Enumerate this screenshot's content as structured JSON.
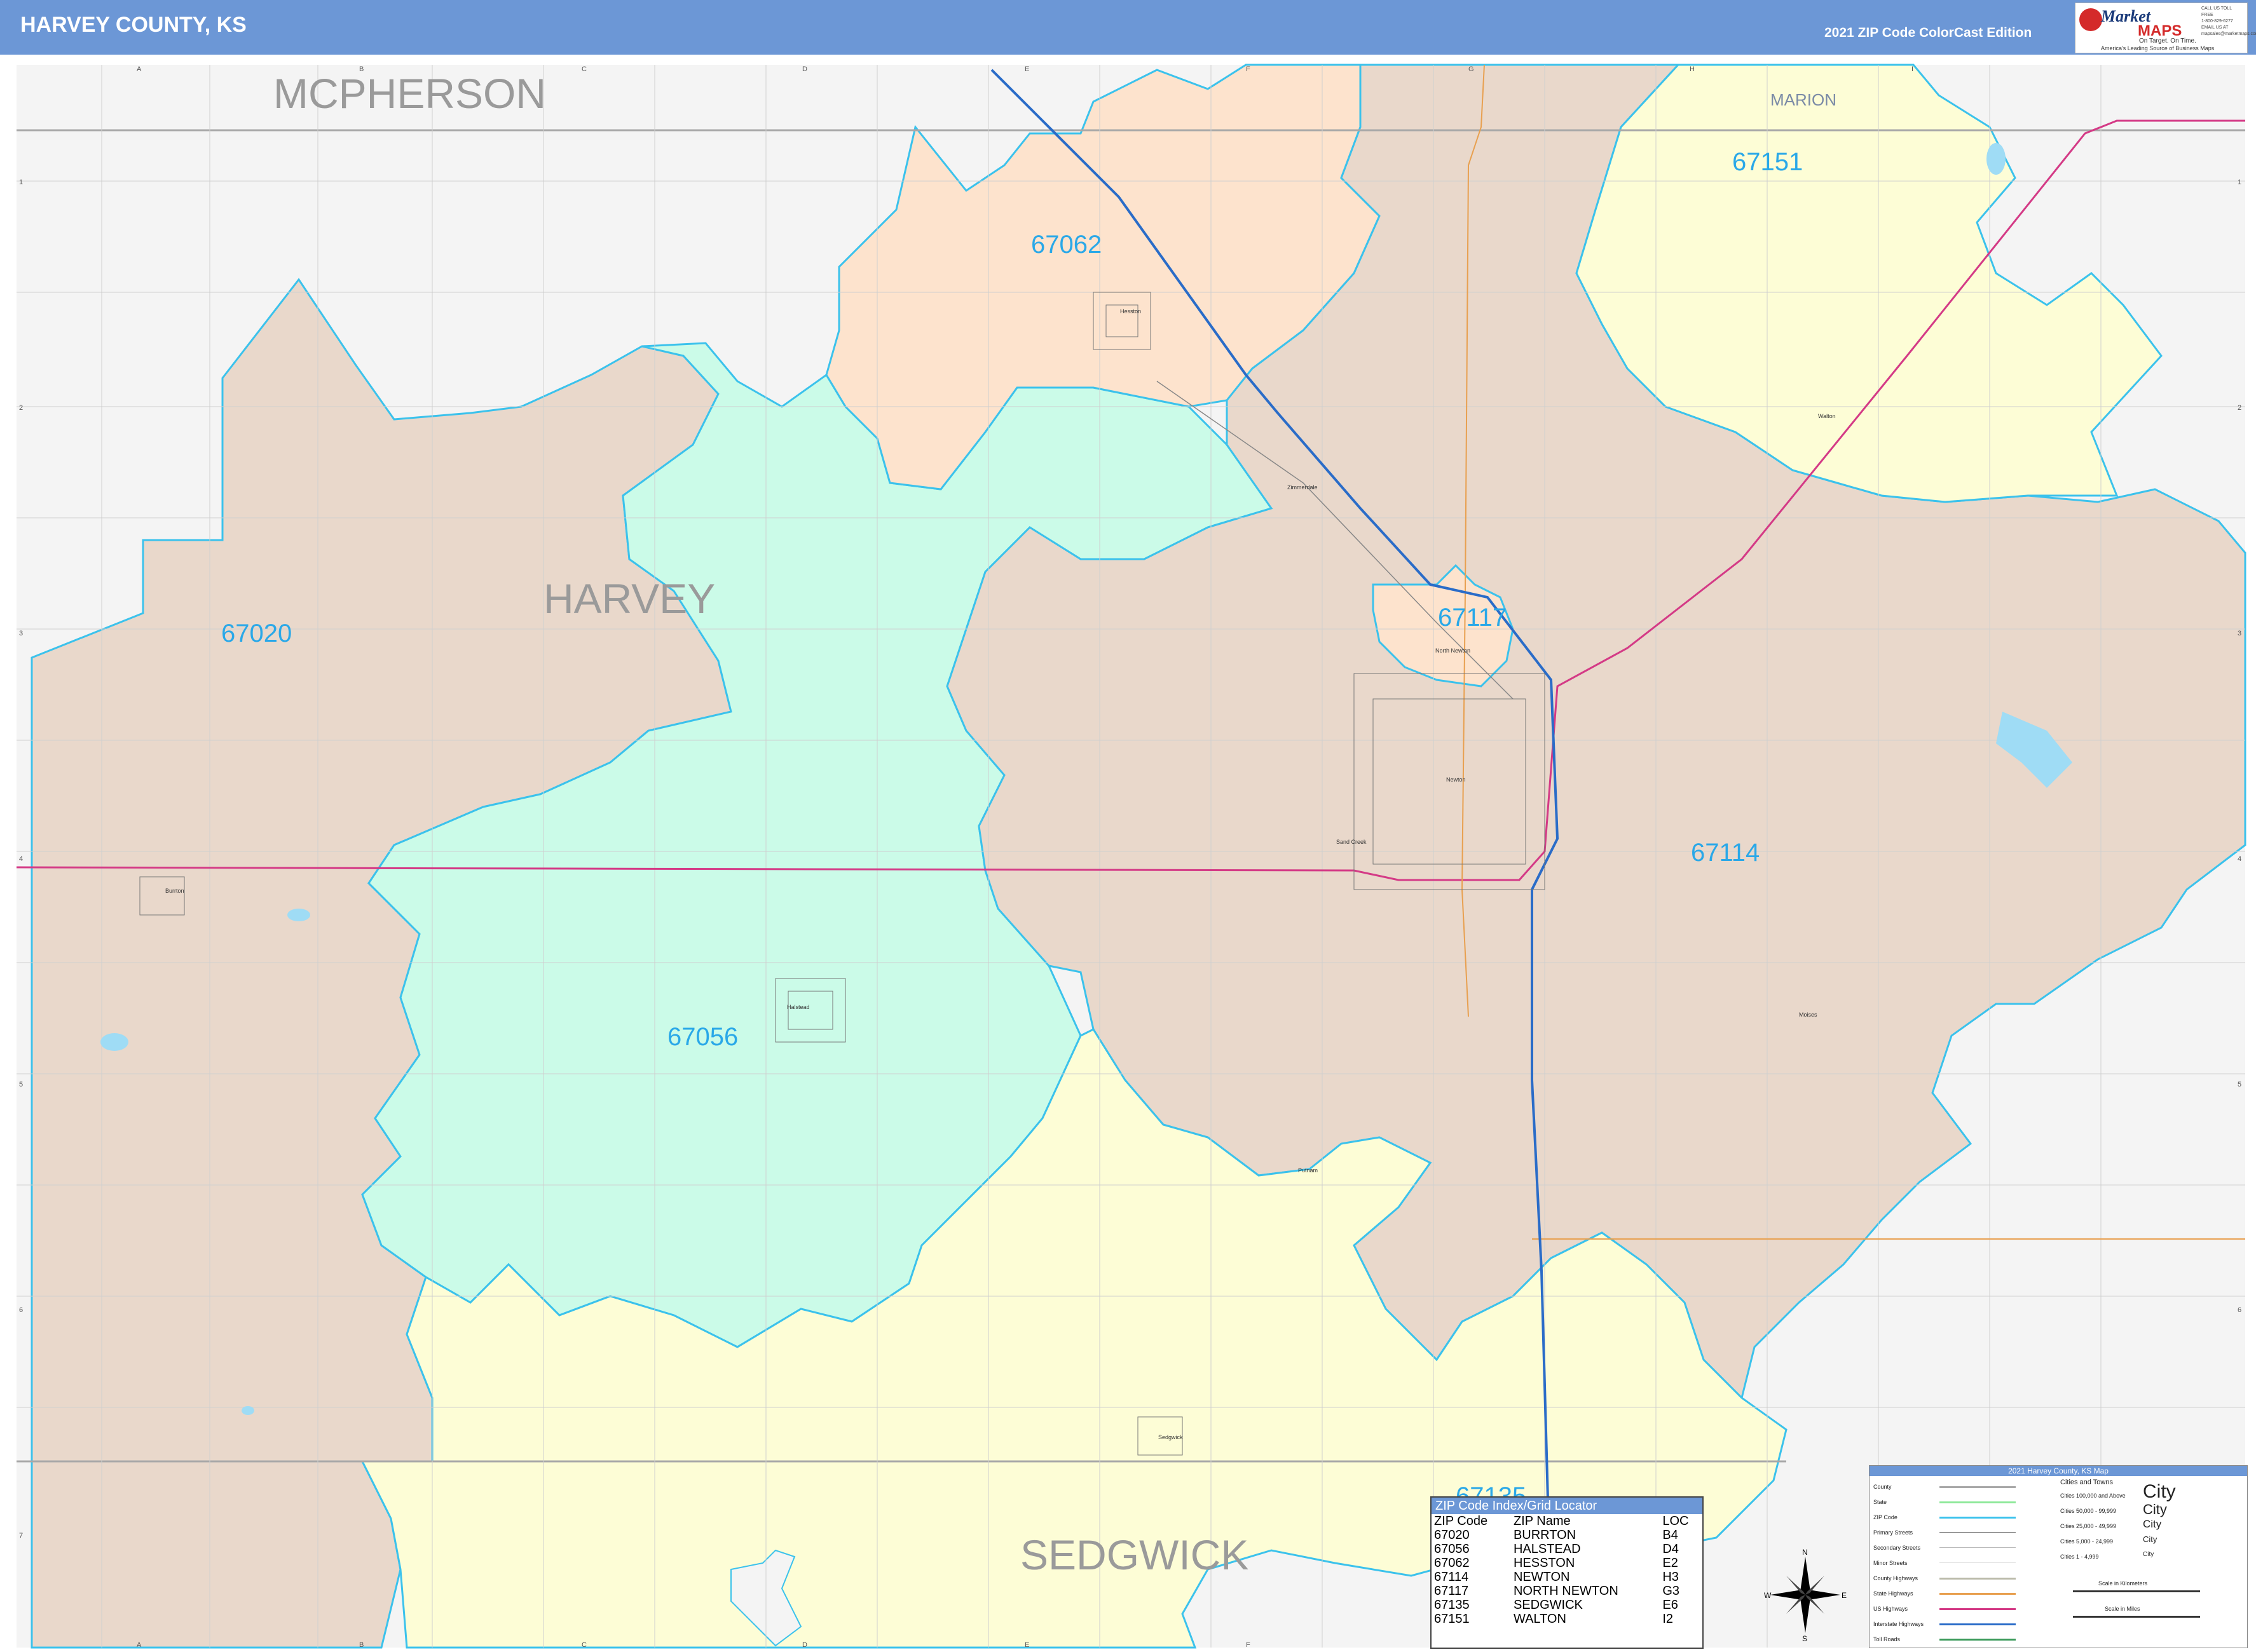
{
  "header": {
    "title": "HARVEY COUNTY, KS",
    "edition": "2021 ZIP Code ColorCast Edition"
  },
  "logo": {
    "word1": "Market",
    "word2": "MAPS",
    "tagline": "On Target. On Time.",
    "subtag": "America's Leading Source of Business Maps",
    "contact": [
      "CALL US TOLL FREE",
      "1-800-829-6277",
      "EMAIL US AT",
      "mapsales@marketmaps.com"
    ]
  },
  "grid": {
    "columns": [
      "A",
      "B",
      "C",
      "D",
      "E",
      "F",
      "G",
      "H",
      "I"
    ],
    "rows": [
      "1",
      "2",
      "3",
      "4",
      "5",
      "6",
      "7"
    ]
  },
  "counties": {
    "mcpherson": "MCPHERSON",
    "harvey": "HARVEY",
    "marion": "MARION",
    "sedgwick": "SEDGWICK"
  },
  "zip_labels": {
    "z67151": "67151",
    "z67062": "67062",
    "z67020": "67020",
    "z67117": "67117",
    "z67114": "67114",
    "z67056": "67056",
    "z67135": "67135"
  },
  "cities": {
    "hesston": "Hesston",
    "zimmerdale": "Zimmerdale",
    "north_newton": "North Newton",
    "newton": "Newton",
    "sand_creek": "Sand Creek",
    "walton": "Walton",
    "burrton": "Burrton",
    "halstead": "Halstead",
    "moises": "Moises",
    "putnam": "Putnam",
    "sedgwick": "Sedgwick"
  },
  "colors": {
    "header": "#6c97d6",
    "zip_boundary": "#3bc2ec",
    "zip_67020": "#e9d8cb",
    "zip_67114": "#e9d8cb",
    "zip_67056": "#cbfbe8",
    "zip_67062": "#fde3cd",
    "zip_67117": "#fde3cd",
    "zip_67151": "#fdfdd6",
    "zip_67135": "#fdfdd6",
    "outside": "#f4f4f4",
    "interstate": "#2a6cc8",
    "us_highway": "#d43a86",
    "state_highway": "#e8a050",
    "zip_label": "#2aa8e8"
  },
  "zip_index": {
    "title": "ZIP Code Index/Grid Locator",
    "headers": [
      "ZIP Code",
      "ZIP Name",
      "LOC"
    ],
    "rows": [
      [
        "67020",
        "BURRTON",
        "B4"
      ],
      [
        "67056",
        "HALSTEAD",
        "D4"
      ],
      [
        "67062",
        "HESSTON",
        "E2"
      ],
      [
        "67114",
        "NEWTON",
        "H3"
      ],
      [
        "67117",
        "NORTH NEWTON",
        "G3"
      ],
      [
        "67135",
        "SEDGWICK",
        "E6"
      ],
      [
        "67151",
        "WALTON",
        "I2"
      ]
    ]
  },
  "legend": {
    "title": "2021 Harvey County, KS Map",
    "left_items": [
      "County",
      "State",
      "ZIP Code",
      "Primary Streets",
      "Secondary Streets",
      "Minor Streets",
      "County Highways",
      "State Highways",
      "US Highways",
      "Interstate Highways",
      "Toll Roads"
    ],
    "cities_title": "Cities and Towns",
    "city_tiers": [
      "Cities 100,000 and Above",
      "Cities 50,000 - 99,999",
      "Cities 25,000 - 49,999",
      "Cities 5,000 - 24,999",
      "Cities 1 - 4,999"
    ],
    "city_samples": [
      "City",
      "City",
      "City",
      "City",
      "City"
    ],
    "scale_km": "Scale in Kilometers",
    "scale_mi": "Scale in Miles"
  },
  "compass": {
    "n": "N",
    "s": "S",
    "e": "E",
    "w": "W"
  }
}
